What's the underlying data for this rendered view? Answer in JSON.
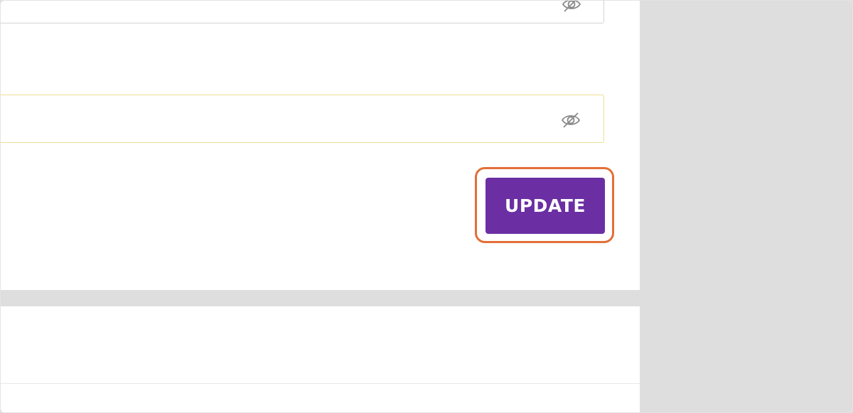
{
  "form": {
    "password_field_1": {
      "value": "",
      "placeholder": "",
      "icon": "eye-slash-icon"
    },
    "password_field_2": {
      "value": "",
      "placeholder": "",
      "icon": "eye-slash-icon"
    },
    "update_button_label": "UPDATE"
  },
  "colors": {
    "button_bg": "#6b2fa3",
    "highlight_border": "#e36f37",
    "field_2_border": "#eedf93",
    "background": "#dedede"
  }
}
